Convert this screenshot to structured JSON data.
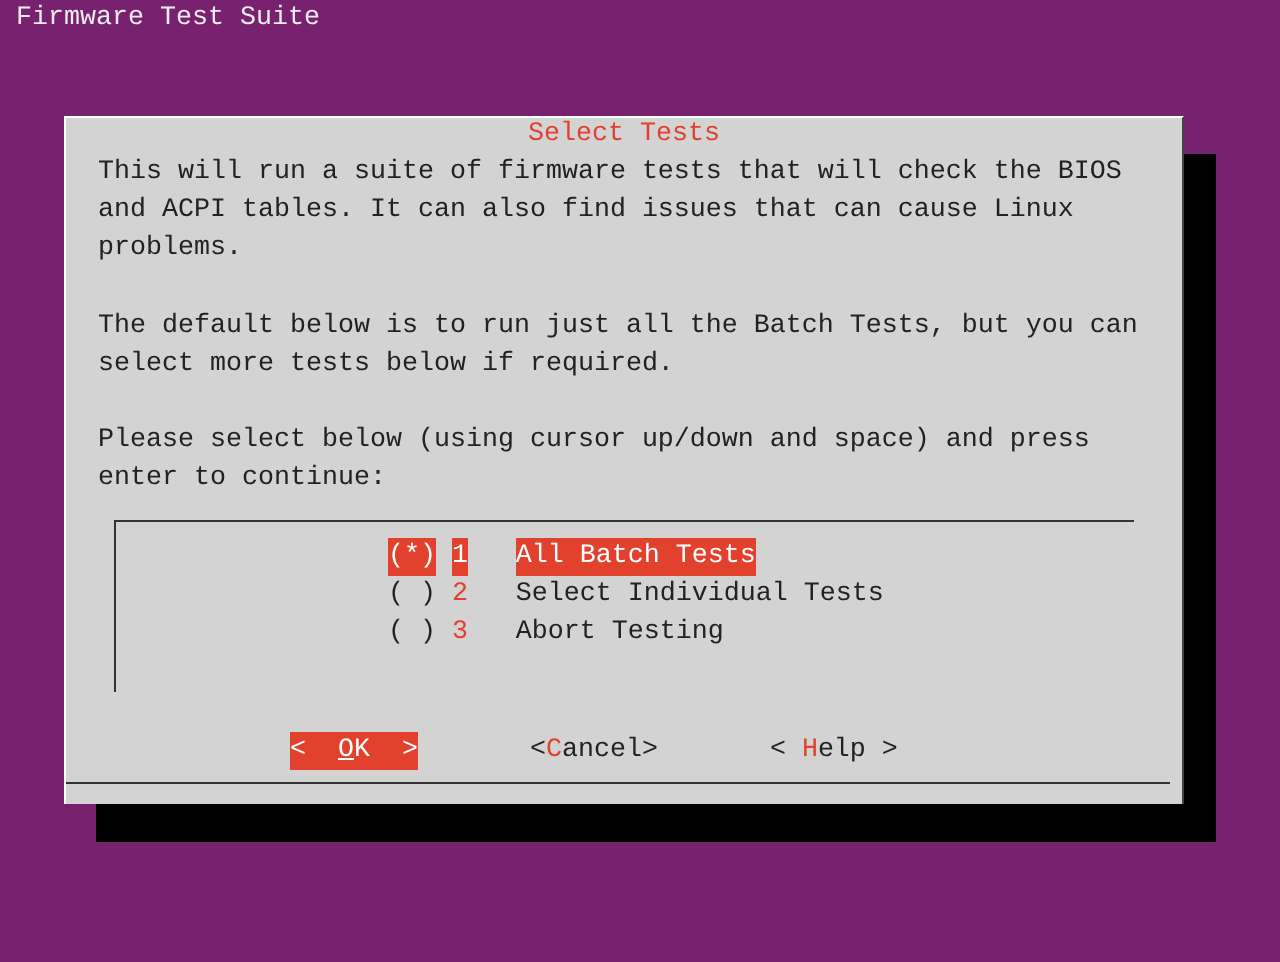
{
  "screen_title": "Firmware Test Suite",
  "dialog": {
    "title": "Select Tests",
    "paragraphs": [
      "This will run a suite of firmware tests that will check the BIOS and ACPI tables. It can also find issues that can cause Linux problems.",
      "The default below is to run just all the Batch Tests, but you can select more tests below if required.",
      "Please select below (using cursor up/down and space) and press enter to continue:"
    ],
    "menu": [
      {
        "marker": "(*)",
        "tag": "1",
        "label": "All Batch Tests",
        "selected": true
      },
      {
        "marker": "( )",
        "tag": "2",
        "label": "Select Individual Tests",
        "selected": false
      },
      {
        "marker": "( )",
        "tag": "3",
        "label": "Abort Testing",
        "selected": false
      }
    ],
    "buttons": [
      {
        "before": "<  ",
        "hotkey": "O",
        "after": "K  >",
        "selected": true
      },
      {
        "before": "<",
        "hotkey": "C",
        "after": "ancel>",
        "selected": false
      },
      {
        "before": "< ",
        "hotkey": "H",
        "after": "elp >",
        "selected": false
      }
    ]
  }
}
